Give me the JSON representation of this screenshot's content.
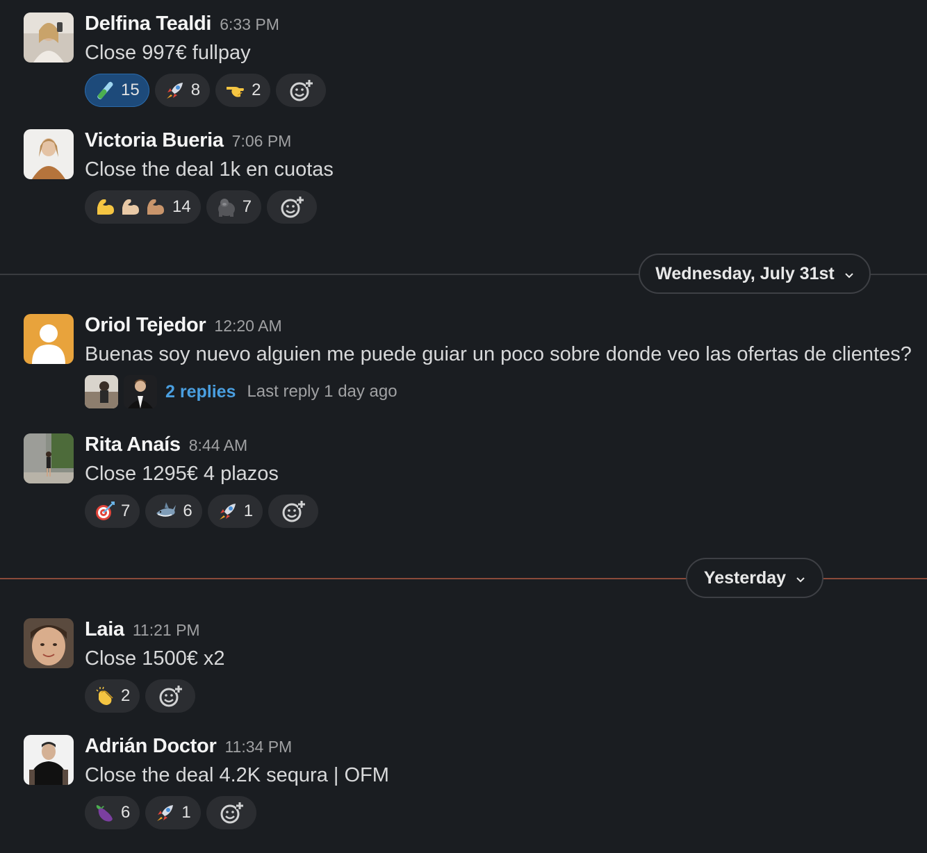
{
  "messages": [
    {
      "name": "Delfina Tealdi",
      "time": "6:33 PM",
      "text": "Close 997€ fullpay",
      "reactions": [
        {
          "emoji": "test-tube",
          "count": "15",
          "active": true
        },
        {
          "emoji": "rocket",
          "count": "8"
        },
        {
          "emoji": "pointing-hand",
          "count": "2"
        }
      ]
    },
    {
      "name": "Victoria Bueria",
      "time": "7:06 PM",
      "text": "Close the deal 1k en cuotas",
      "reactions": [
        {
          "emoji": "flexed-biceps-x3",
          "count": "14"
        },
        {
          "emoji": "gorilla",
          "count": "7"
        }
      ]
    },
    {
      "name": "Oriol Tejedor",
      "time": "12:20 AM",
      "text": "Buenas soy nuevo alguien me puede guiar un poco sobre donde veo las ofertas de clientes?",
      "thread": {
        "replies_label": "2 replies",
        "last_reply": "Last reply 1 day ago"
      }
    },
    {
      "name": "Rita Anaís",
      "time": "8:44 AM",
      "text": "Close 1295€ 4 plazos",
      "reactions": [
        {
          "emoji": "direct-hit",
          "count": "7"
        },
        {
          "emoji": "shark",
          "count": "6"
        },
        {
          "emoji": "rocket",
          "count": "1"
        }
      ]
    },
    {
      "name": "Laia",
      "time": "11:21 PM",
      "text": "Close 1500€ x2",
      "reactions": [
        {
          "emoji": "clapping-hands",
          "count": "2"
        }
      ]
    },
    {
      "name": "Adrián Doctor",
      "time": "11:34 PM",
      "text": "Close the deal 4.2K sequra | OFM",
      "reactions": [
        {
          "emoji": "eggplant",
          "count": "6"
        },
        {
          "emoji": "rocket",
          "count": "1"
        }
      ]
    }
  ],
  "dividers": [
    {
      "label": "Wednesday, July 31st",
      "line_color": "#3a3c40"
    },
    {
      "label": "Yesterday",
      "line_color": "#8a4a3a"
    }
  ],
  "icons": {
    "add_reaction": "add-reaction-icon",
    "chevron": "chevron-down-icon"
  }
}
